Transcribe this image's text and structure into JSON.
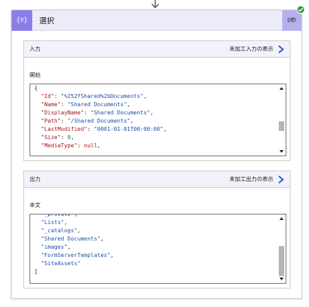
{
  "action": {
    "title": "選択",
    "duration": "0秒",
    "icon": "data-operation-icon"
  },
  "input": {
    "header": "入力",
    "show_raw": "未加工入力の表示",
    "field_label": "開始",
    "code_lines": [
      [
        {
          "c": "p",
          "t": "{"
        }
      ],
      [
        {
          "c": "p",
          "t": "  "
        },
        {
          "c": "k",
          "t": "\"Id\""
        },
        {
          "c": "p",
          "t": ": "
        },
        {
          "c": "s",
          "t": "\"%252fShared%2bDocuments\""
        },
        {
          "c": "p",
          "t": ","
        }
      ],
      [
        {
          "c": "p",
          "t": "  "
        },
        {
          "c": "k",
          "t": "\"Name\""
        },
        {
          "c": "p",
          "t": ": "
        },
        {
          "c": "s",
          "t": "\"Shared Documents\""
        },
        {
          "c": "p",
          "t": ","
        }
      ],
      [
        {
          "c": "p",
          "t": "  "
        },
        {
          "c": "k",
          "t": "\"DisplayName\""
        },
        {
          "c": "p",
          "t": ": "
        },
        {
          "c": "s",
          "t": "\"Shared Documents\""
        },
        {
          "c": "p",
          "t": ","
        }
      ],
      [
        {
          "c": "p",
          "t": "  "
        },
        {
          "c": "k",
          "t": "\"Path\""
        },
        {
          "c": "p",
          "t": ": "
        },
        {
          "c": "s",
          "t": "\"/Shared Documents\""
        },
        {
          "c": "p",
          "t": ","
        }
      ],
      [
        {
          "c": "p",
          "t": "  "
        },
        {
          "c": "k",
          "t": "\"LastModified\""
        },
        {
          "c": "p",
          "t": ": "
        },
        {
          "c": "s",
          "t": "\"0001-01-01T00:00:00\""
        },
        {
          "c": "p",
          "t": ","
        }
      ],
      [
        {
          "c": "p",
          "t": "  "
        },
        {
          "c": "k",
          "t": "\"Size\""
        },
        {
          "c": "p",
          "t": ": "
        },
        {
          "c": "n",
          "t": "0"
        },
        {
          "c": "p",
          "t": ","
        }
      ],
      [
        {
          "c": "p",
          "t": "  "
        },
        {
          "c": "k",
          "t": "\"MediaType\""
        },
        {
          "c": "p",
          "t": ": "
        },
        {
          "c": "k",
          "t": "null"
        },
        {
          "c": "p",
          "t": ","
        }
      ]
    ]
  },
  "output": {
    "header": "出力",
    "show_raw": "未加工出力の表示",
    "field_label": "本文",
    "code_lines": [
      [
        {
          "c": "p",
          "t": "  "
        },
        {
          "c": "s",
          "t": "\"_private\""
        },
        {
          "c": "p",
          "t": ","
        }
      ],
      [
        {
          "c": "p",
          "t": "  "
        },
        {
          "c": "s",
          "t": "\"Lists\""
        },
        {
          "c": "p",
          "t": ","
        }
      ],
      [
        {
          "c": "p",
          "t": "  "
        },
        {
          "c": "s",
          "t": "\"_catalogs\""
        },
        {
          "c": "p",
          "t": ","
        }
      ],
      [
        {
          "c": "p",
          "t": "  "
        },
        {
          "c": "s",
          "t": "\"Shared Documents\""
        },
        {
          "c": "p",
          "t": ","
        }
      ],
      [
        {
          "c": "p",
          "t": "  "
        },
        {
          "c": "s",
          "t": "\"images\""
        },
        {
          "c": "p",
          "t": ","
        }
      ],
      [
        {
          "c": "p",
          "t": "  "
        },
        {
          "c": "s",
          "t": "\"FormServerTemplates\""
        },
        {
          "c": "p",
          "t": ","
        }
      ],
      [
        {
          "c": "p",
          "t": "  "
        },
        {
          "c": "s",
          "t": "\"SiteAssets\""
        }
      ],
      [
        {
          "c": "p",
          "t": "]"
        }
      ]
    ]
  },
  "colors": {
    "accent": "#8a7fe8",
    "header_bg": "#ecebf8",
    "success": "#2f9e44",
    "json_key": "#a31515",
    "json_string": "#1d4ca8"
  }
}
